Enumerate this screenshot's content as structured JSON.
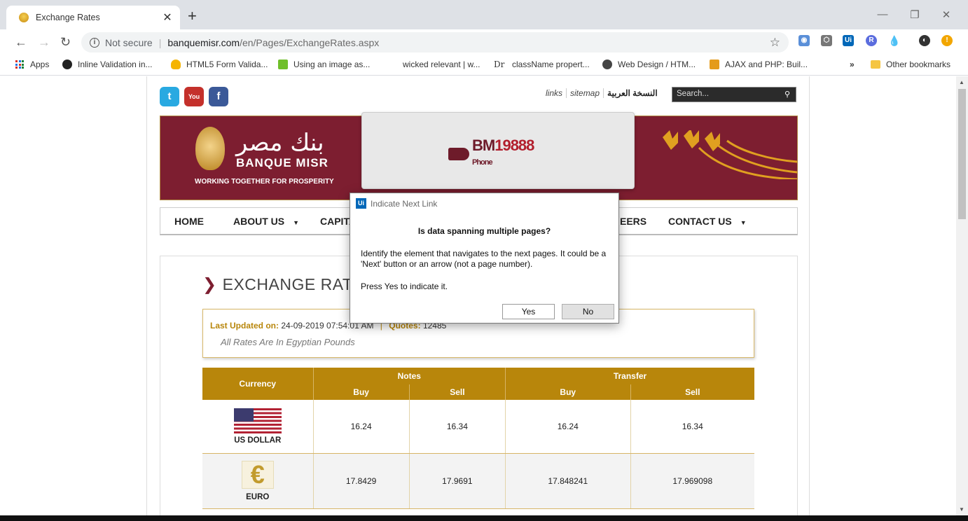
{
  "browser": {
    "tab_title": "Exchange Rates",
    "not_secure": "Not secure",
    "url_domain": "banquemisr.com",
    "url_path": "/en/Pages/ExchangeRates.aspx",
    "bookmarks": [
      "Apps",
      "Inline Validation in...",
      "HTML5 Form Valida...",
      "Using an image as...",
      "wicked relevant | w...",
      "className propert...",
      "Web Design / HTM...",
      "AJAX and PHP: Buil..."
    ],
    "other_bookmarks": "Other bookmarks",
    "overflow": "»"
  },
  "site": {
    "top_links": [
      "links",
      "sitemap"
    ],
    "arabic_link": "النسخة العربية",
    "search_placeholder": "Search...",
    "brand_arabic": "بنك مصر",
    "brand_name": "BANQUE MISR",
    "tagline": "WORKING TOGETHER FOR PROSPERITY",
    "ad_number": "19888",
    "ad_brand": "BM",
    "ad_phone": "Phone",
    "nav": [
      "HOME",
      "ABOUT US",
      "CAPITA",
      "EERS",
      "CONTACT US"
    ],
    "page_title": "EXCHANGE RATES",
    "last_updated_label": "Last Updated on:",
    "last_updated_value": "24-09-2019 07:54:01 AM",
    "quotes_label": "Quotes:",
    "quotes_value": "12485",
    "rates_note": "All Rates Are In Egyptian Pounds"
  },
  "table": {
    "currency_header": "Currency",
    "notes_header": "Notes",
    "transfer_header": "Transfer",
    "buy": "Buy",
    "sell": "Sell",
    "rows": [
      {
        "currency": "US DOLLAR",
        "notes_buy": "16.24",
        "notes_sell": "16.34",
        "transfer_buy": "16.24",
        "transfer_sell": "16.34"
      },
      {
        "currency": "EURO",
        "notes_buy": "17.8429",
        "notes_sell": "17.9691",
        "transfer_buy": "17.848241",
        "transfer_sell": "17.969098"
      }
    ]
  },
  "dialog": {
    "logo": "Ui",
    "title": "Indicate Next Link",
    "question": "Is data spanning multiple pages?",
    "body": "Identify the element that navigates to the next pages. It could be a 'Next' button or an arrow (not a page number).",
    "body2": "Press Yes to indicate it.",
    "yes": "Yes",
    "no": "No"
  }
}
